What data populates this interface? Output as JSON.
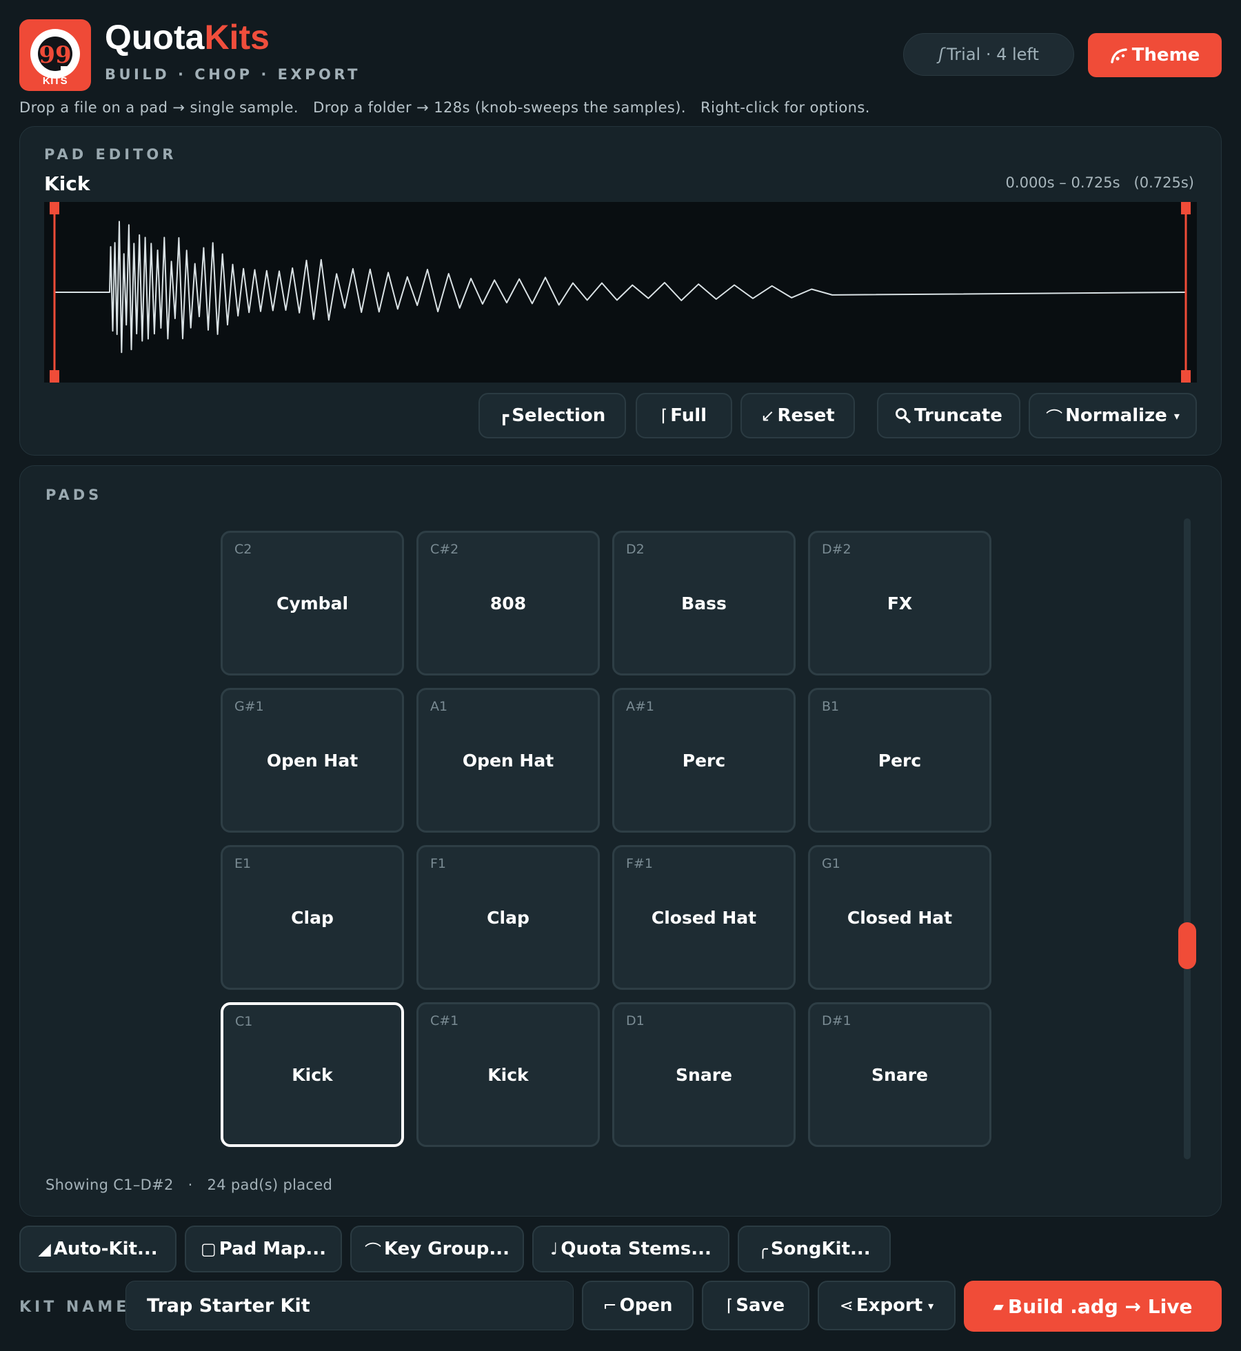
{
  "app": {
    "logo_label": "KITS",
    "logo_glyph": "99",
    "brand_part1": "Quota",
    "brand_part2": "Kits",
    "tagline": "BUILD · CHOP · EXPORT",
    "hint": "Drop a file on a pad → single sample.   Drop a folder → 128s (knob-sweeps the samples).   Right-click for options."
  },
  "header": {
    "trial_label": "Trial · 4 left",
    "trial_icon": "trial-icon",
    "theme_label": "Theme",
    "theme_icon": "theme-icon"
  },
  "colors": {
    "accent": "#f04c38",
    "background": "#111a1f",
    "panel": "#172329",
    "pad": "#1e2c33",
    "waveform": "#d9e1e4"
  },
  "pad_editor": {
    "section_label": "PAD EDITOR",
    "sample_name": "Kick",
    "range_text": "0.000s – 0.725s   (0.725s)",
    "buttons": {
      "selection": "Selection",
      "full": "Full",
      "reset": "Reset",
      "truncate": "Truncate",
      "normalize": "Normalize",
      "normalize_caret": "▾"
    }
  },
  "pads": {
    "section_label": "PADS",
    "grid": [
      {
        "note": "C2",
        "name": "Cymbal"
      },
      {
        "note": "C#2",
        "name": "808"
      },
      {
        "note": "D2",
        "name": "Bass"
      },
      {
        "note": "D#2",
        "name": "FX"
      },
      {
        "note": "G#1",
        "name": "Open Hat"
      },
      {
        "note": "A1",
        "name": "Open Hat"
      },
      {
        "note": "A#1",
        "name": "Perc"
      },
      {
        "note": "B1",
        "name": "Perc"
      },
      {
        "note": "E1",
        "name": "Clap"
      },
      {
        "note": "F1",
        "name": "Clap"
      },
      {
        "note": "F#1",
        "name": "Closed Hat"
      },
      {
        "note": "G1",
        "name": "Closed Hat"
      },
      {
        "note": "C1",
        "name": "Kick"
      },
      {
        "note": "C#1",
        "name": "Kick"
      },
      {
        "note": "D1",
        "name": "Snare"
      },
      {
        "note": "D#1",
        "name": "Snare"
      }
    ],
    "selected_note": "C1",
    "showing": "Showing C1–D#2",
    "separator": "·",
    "placed": "24 pad(s) placed"
  },
  "tools": {
    "auto_kit": "Auto-Kit...",
    "pad_map": "Pad Map...",
    "key_group": "Key Group...",
    "quota_stems": "Quota Stems...",
    "songkit": "SongKit..."
  },
  "footer": {
    "kit_name_label": "KIT NAME",
    "kit_name_value": "Trap Starter Kit",
    "open": "Open",
    "save": "Save",
    "export": "Export",
    "export_caret": "▾",
    "build": "Build .adg → Live"
  }
}
